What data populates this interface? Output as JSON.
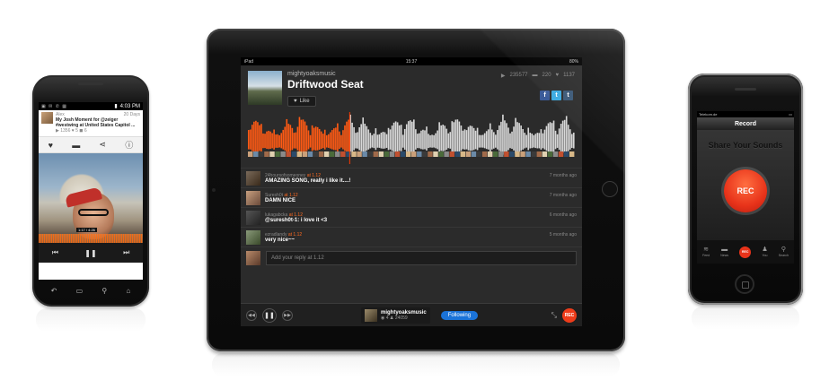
{
  "android": {
    "status_time": "4:03 PM",
    "track": {
      "user": "Alex",
      "age": "20 Days",
      "title": "My Josh Moment for @zeiger #westwing at United States Capitol ...",
      "stats": "▶ 1356  ♥ 5  ◼ 6"
    },
    "photo_time": "1:17 / 4:26"
  },
  "ipad": {
    "status": {
      "device": "iPad",
      "time": "15:37",
      "battery": "80%"
    },
    "track": {
      "user": "mightyoaksmusic",
      "title": "Driftwood Seat",
      "like_label": "Like",
      "plays": "235577",
      "comments": "220",
      "likes": "1137"
    },
    "comments": [
      {
        "user": "24hoursofsomeoney",
        "at": "at 1.12",
        "text": "AMAZING SONG, really i like it....!",
        "when": "7 months ago"
      },
      {
        "user": "Suresh0t",
        "at": "at 1.12",
        "text": "DAMN NICE",
        "when": "7 months ago"
      },
      {
        "user": "lukagabcka",
        "at": "at 1.12",
        "text": "@suresh0t-1: i love it <3",
        "when": "6 months ago"
      },
      {
        "user": "ezradlandy",
        "at": "at 1.12",
        "text": "very nice~~",
        "when": "5 months ago"
      }
    ],
    "reply_placeholder": "Add your reply at 1.12",
    "player": {
      "user": "mightyoaksmusic",
      "tracks": "4",
      "followers": "24059",
      "follow_label": "Following",
      "rec_label": "REC"
    },
    "waveform": {
      "progress": 0.31
    }
  },
  "iphone": {
    "carrier": "Telekom.de",
    "nav_title": "Record",
    "headline": "Share Your Sounds",
    "rec_label": "REC",
    "tabs": [
      "Feed",
      "News",
      "REC",
      "You",
      "Search"
    ]
  }
}
